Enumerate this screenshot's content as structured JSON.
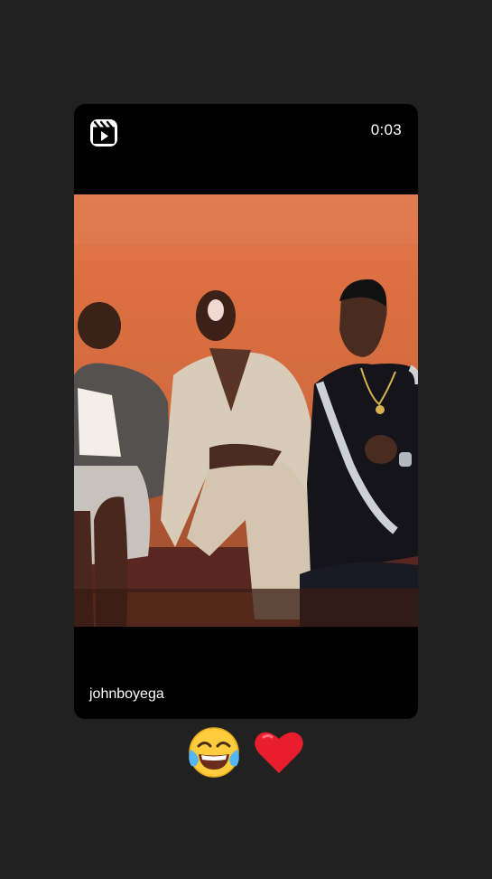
{
  "story": {
    "reel_icon": "reels-icon",
    "duration": "0:03",
    "username": "johnboyega",
    "video_description_icon": "video-thumbnail"
  },
  "reactions": [
    {
      "icon": "face-with-tears-of-joy-emoji"
    },
    {
      "icon": "red-heart-emoji"
    }
  ],
  "colors": {
    "background": "#212121",
    "card": "#000000",
    "video_backdrop": "#dc6f41"
  }
}
